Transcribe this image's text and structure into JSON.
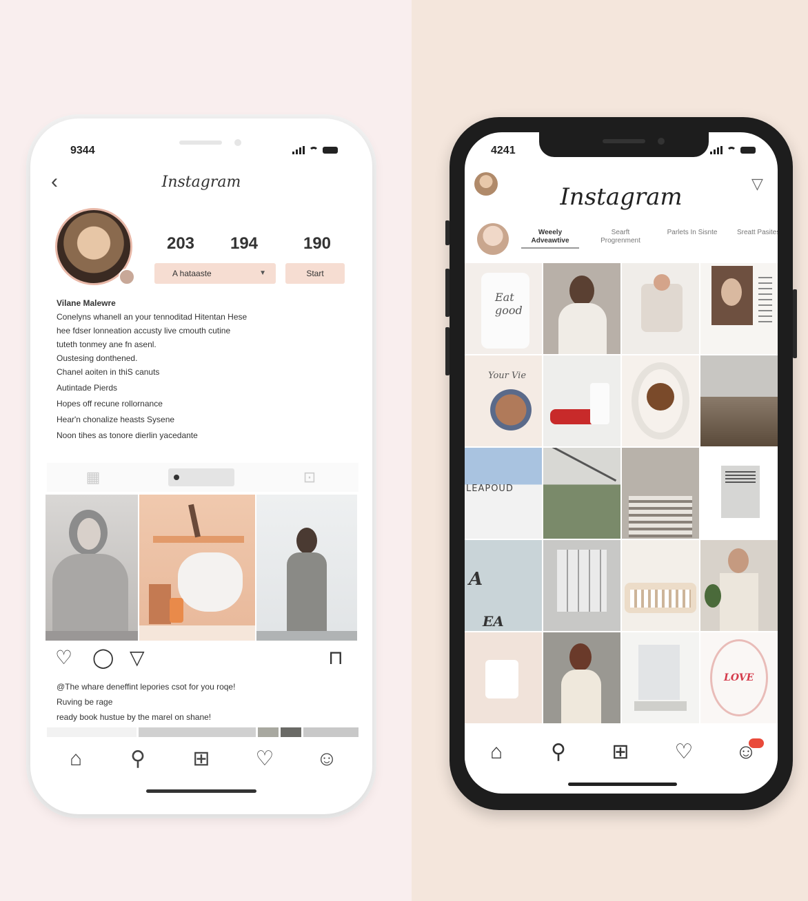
{
  "colors": {
    "accent_pill": "#f6ddd2",
    "notification": "#e94a3a",
    "left_bg": "#f9eeee",
    "right_bg": "#f4e6dc"
  },
  "left_phone": {
    "status_time": "9344",
    "app_title": "Instagram",
    "back_icon": "chevron-left-icon",
    "stats": [
      "203",
      "194",
      "190"
    ],
    "select_label": "A hataaste",
    "button_label": "Start",
    "bio": {
      "name": "Vilane Malewre",
      "lines": [
        "Conelyns whanell an your tennoditad Hitentan Hese",
        "hee fdser lonneation accusty live cmouth cutine",
        "tuteth tonmey ane fn asenl.",
        "Oustesing donthened.",
        "Chanel aoiten in thiS canuts",
        "Autintade Pierds",
        "Hopes off recune rollornance",
        "Hear'n chonalize heasts Sysene",
        "Noon tihes as tonore dierlin yacedante"
      ]
    },
    "caption": [
      "@The whare deneffint lepories csot for you roqe!",
      "Ruving be rage",
      "ready book hustue by the marel on shane!"
    ],
    "nav_icons": [
      "home-icon",
      "search-icon",
      "add-post-icon",
      "heart-icon",
      "profile-icon"
    ]
  },
  "right_phone": {
    "status_time": "4241",
    "app_title": "Instagram",
    "stories": [
      "Weeely Adveawtive",
      "Searft Progrenment",
      "Parlets In Sisnte",
      "Sreatt Pasitesiu"
    ],
    "grid_texts": {
      "cup_text": "Eat good",
      "poster_text": "Your Vie",
      "sign_text": "LEAPOUD",
      "letter_a": "A",
      "letter_ea": "EA",
      "card_text": "LOVE"
    },
    "nav_icons": [
      "home-icon",
      "search-icon",
      "add-post-icon",
      "heart-icon",
      "profile-icon"
    ]
  }
}
